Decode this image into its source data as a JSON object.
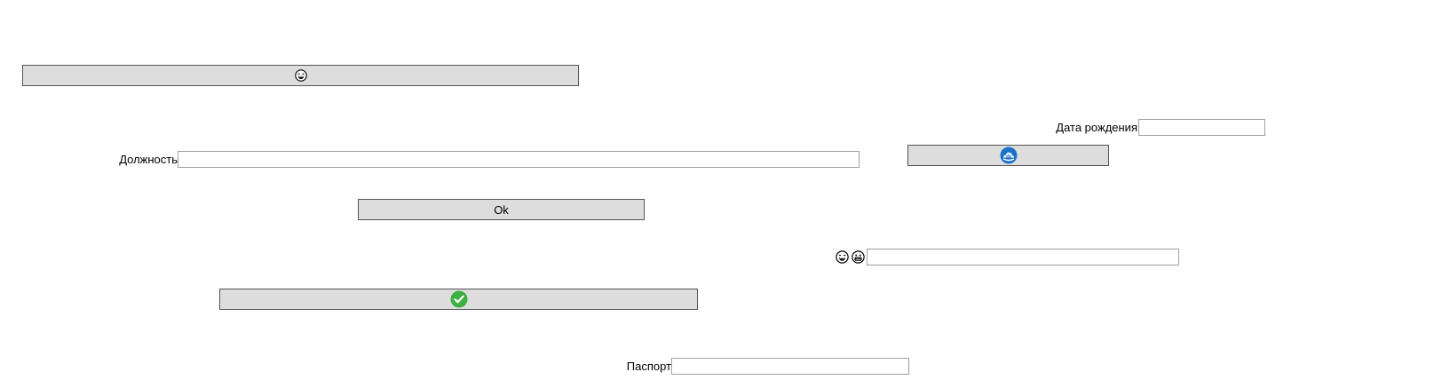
{
  "buttons": {
    "top_emoji_button": {
      "icon": "laughing-face-icon"
    },
    "cloud_button": {
      "icon": "cloud-app-icon",
      "color": "#1a73c9"
    },
    "ok_button": {
      "label": "Ok"
    },
    "check_button": {
      "icon": "green-check-icon",
      "color": "#3cb043"
    }
  },
  "fields": {
    "birth_date": {
      "label": "Дата рождения",
      "value": ""
    },
    "position": {
      "label": "Должность",
      "value": ""
    },
    "emoji_field": {
      "icons": [
        "laughing-face-icon",
        "grinning-face-icon"
      ],
      "value": ""
    },
    "passport": {
      "label": "Паспорт",
      "value": ""
    }
  }
}
